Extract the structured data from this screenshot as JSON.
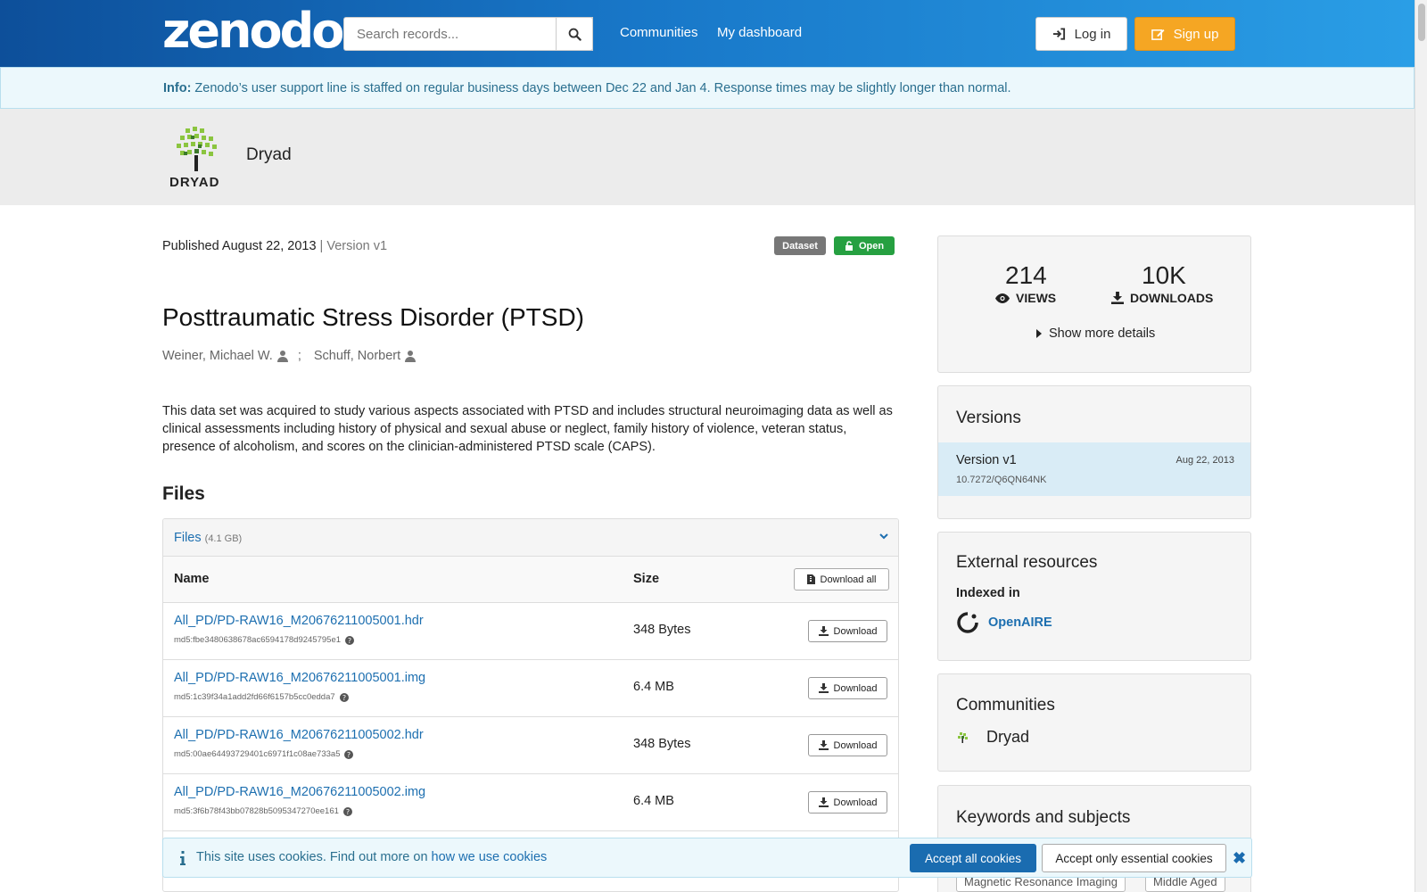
{
  "header": {
    "logo": "zenodo",
    "search_placeholder": "Search records...",
    "nav": [
      "Communities",
      "My dashboard"
    ],
    "login": "Log in",
    "signup": "Sign up"
  },
  "info_banner": {
    "label": "Info:",
    "text": " Zenodo’s user support line is staffed on regular business days between Dec 22 and Jan 4. Response times may be slightly longer than normal."
  },
  "community": {
    "logo_text": "DRYAD",
    "name": "Dryad"
  },
  "record": {
    "published": "Published August 22, 2013",
    "version": " | Version v1",
    "badge_type": "Dataset",
    "badge_access": "Open",
    "title": "Posttraumatic Stress Disorder (PTSD)",
    "authors": [
      "Weiner, Michael W.",
      "Schuff, Norbert"
    ],
    "author_sep": ";",
    "description": "This data set was acquired to study various aspects associated with PTSD and includes structural neuroimaging data as well as clinical assessments including history of physical and sexual abuse or neglect, family history of violence, veteran status, presence of alcoholism, and scores on the clinician-administered PTSD scale (CAPS)."
  },
  "files": {
    "heading": "Files",
    "panel_label": "Files",
    "panel_size": "(4.1 GB)",
    "col_name": "Name",
    "col_size": "Size",
    "download_all": "Download all",
    "download": "Download",
    "rows": [
      {
        "name": "All_PD/PD-RAW16_M20676211005001.hdr",
        "md5": "md5:fbe3480638678ac6594178d9245795e1",
        "size": "348 Bytes"
      },
      {
        "name": "All_PD/PD-RAW16_M20676211005001.img",
        "md5": "md5:1c39f34a1add2fd66f6157b5cc0edda7",
        "size": "6.4 MB"
      },
      {
        "name": "All_PD/PD-RAW16_M20676211005002.hdr",
        "md5": "md5:00ae64493729401c6971f1c08ae733a5",
        "size": "348 Bytes"
      },
      {
        "name": "All_PD/PD-RAW16_M20676211005002.img",
        "md5": "md5:3f6b78f43bb07828b5095347270ee161",
        "size": "6.4 MB"
      }
    ]
  },
  "stats": {
    "views": "214",
    "views_label": "VIEWS",
    "downloads": "10K",
    "downloads_label": "DOWNLOADS",
    "show_more": "Show more details"
  },
  "versions": {
    "title": "Versions",
    "item_name": "Version v1",
    "item_date": "Aug 22, 2013",
    "item_doi": "10.7272/Q6QN64NK"
  },
  "external": {
    "title": "External resources",
    "indexed": "Indexed in",
    "openaire": "OpenAIRE"
  },
  "communities": {
    "title": "Communities",
    "item": "Dryad"
  },
  "keywords": {
    "title": "Keywords and subjects",
    "chips": [
      "Magnetic Resonance Imaging",
      "Middle Aged"
    ]
  },
  "cookie": {
    "text": "This site uses cookies. Find out more on ",
    "link": "how we use cookies",
    "accept_all": "Accept all cookies",
    "accept_essential": "Accept only essential cookies"
  },
  "colors": {
    "brand_dark": "#0d4f9a",
    "brand_light": "#2a9ee6",
    "signup": "#f5a623",
    "open_badge": "#26a041",
    "link": "#1d6fb0"
  }
}
